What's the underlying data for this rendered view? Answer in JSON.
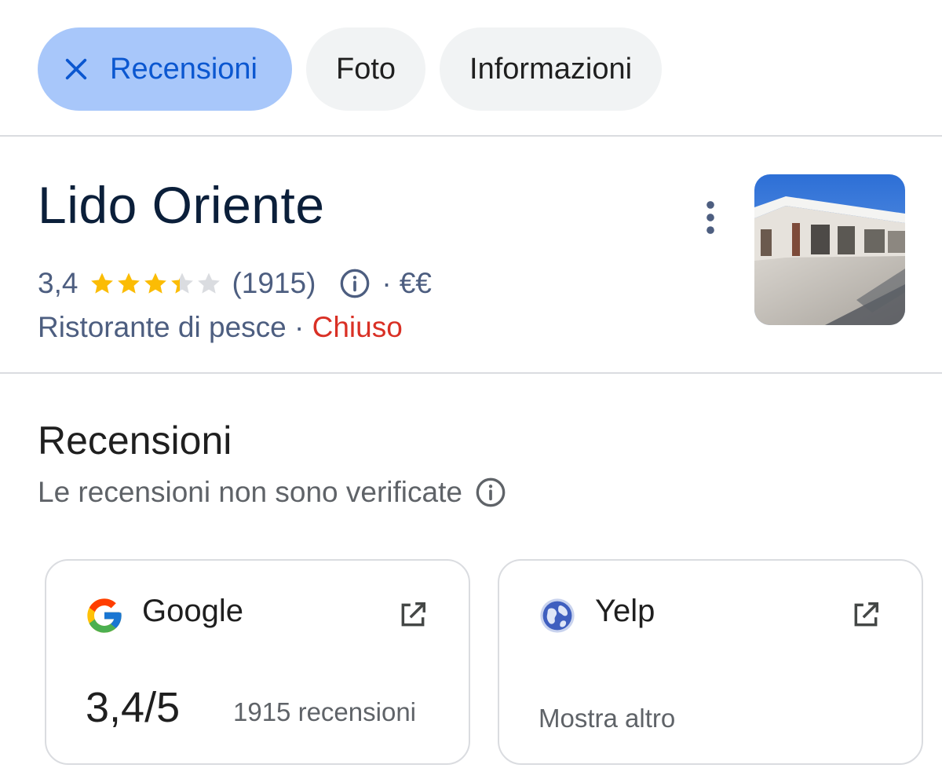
{
  "chips": {
    "reviews_label": "Recensioni",
    "photos_label": "Foto",
    "info_label": "Informazioni"
  },
  "place": {
    "name": "Lido Oriente",
    "rating": "3,4",
    "rating_value": 3.4,
    "rating_max": 5,
    "review_count": "(1915)",
    "separator": "·",
    "price": "€€",
    "category": "Ristorante di pesce",
    "status": "Chiuso",
    "status_color": "#d93025"
  },
  "reviews": {
    "title": "Recensioni",
    "subtitle": "Le recensioni non sono verificate",
    "sources": [
      {
        "name": "Google",
        "icon": "google-logo-icon",
        "score": "3,4/5",
        "count": "1915 recensioni"
      },
      {
        "name": "Yelp",
        "icon": "globe-icon",
        "more": "Mostra altro"
      }
    ]
  },
  "colors": {
    "active_chip_bg": "#a8c7fa",
    "active_chip_text": "#0b57d0",
    "star": "#fbbc04",
    "star_empty": "#dadce0"
  }
}
